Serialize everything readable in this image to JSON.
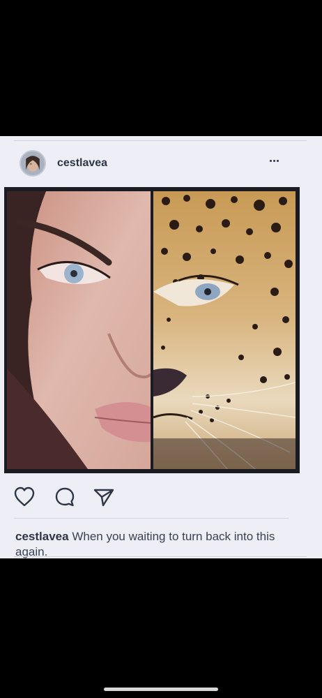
{
  "post": {
    "username": "cestlavea",
    "more_icon": "more-horizontal-icon",
    "caption": {
      "username": "cestlavea",
      "text": "When you waiting to turn back into this again."
    },
    "actions": {
      "like_icon": "heart-icon",
      "comment_icon": "comment-bubble-icon",
      "share_icon": "paper-plane-icon"
    },
    "image": {
      "left_half": "woman-face-half",
      "right_half": "leopard-face-half"
    }
  },
  "colors": {
    "background": "#eeeff6",
    "text": "#2d3546",
    "screen": "#000000"
  }
}
